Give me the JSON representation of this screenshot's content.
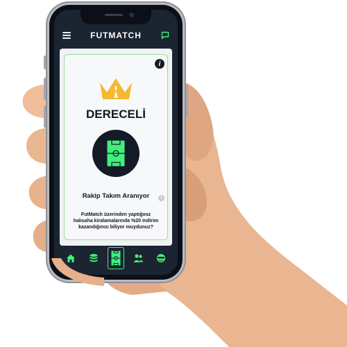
{
  "app": {
    "brand": "FUTMATCH"
  },
  "card": {
    "title": "DERECELİ",
    "status": "Rakip Takım Aranıyor",
    "promo": "FutMatch üzerinden yaptığınız halısaha kiralamalarında %20 indirim kazandığınızı biliyor muydunuz?",
    "info_icon": "info-icon",
    "crown_icon": "crown-icon",
    "pitch_icon": "football-pitch-icon"
  },
  "nav": {
    "items": [
      {
        "icon": "home-icon"
      },
      {
        "icon": "coins-icon"
      },
      {
        "icon": "pitch-icon"
      },
      {
        "icon": "users-icon"
      },
      {
        "icon": "referee-icon"
      }
    ]
  },
  "colors": {
    "accent_green": "#3ff07c",
    "dark_navy": "#1b2431",
    "crown_yellow": "#f5b82e",
    "card_border": "#9bd9a3"
  }
}
